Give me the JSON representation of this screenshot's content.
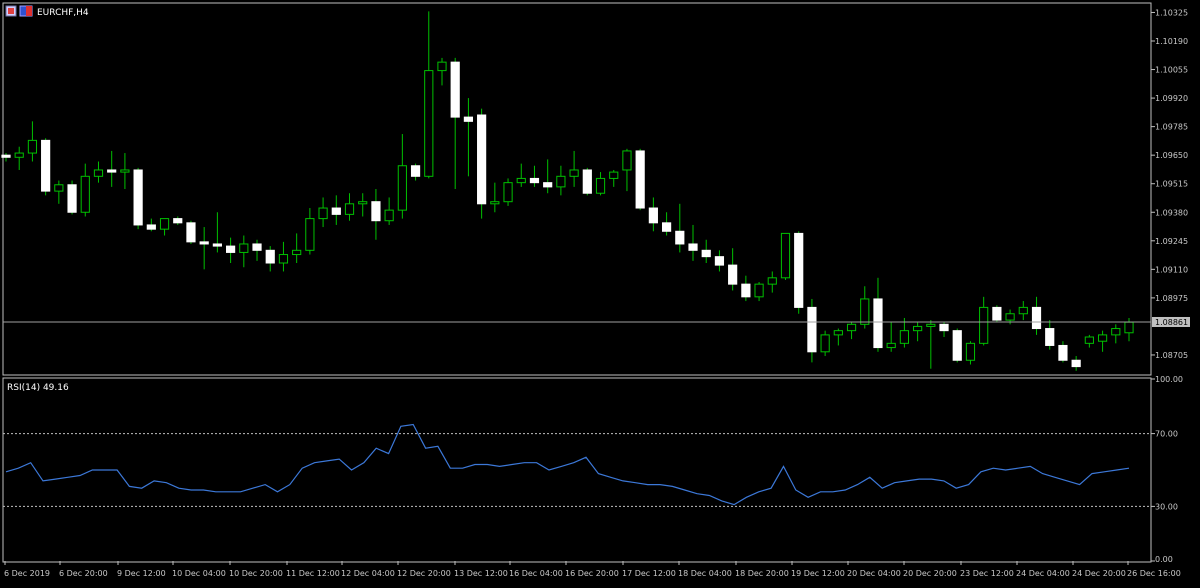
{
  "window": {
    "symbol_label": "EURCHF,H4"
  },
  "colors": {
    "background": "#000000",
    "frame": "#c0c0c0",
    "text": "#c8c8c8",
    "bull_candle_fill": "#000000",
    "bear_candle_fill": "#ffffff",
    "wick": "#00c000",
    "bull_border": "#00c000",
    "bear_border": "#ffffff",
    "price_line": "#a0a0a0",
    "rsi_line": "#3c78d8",
    "rsi_level": "#c0c0c0",
    "price_tag_bg": "#c0c0c0",
    "price_tag_text": "#000000"
  },
  "chart_data": [
    {
      "type": "candlestick",
      "title": "EURCHF,H4",
      "y_ticks": [
        "1.10325",
        "1.10190",
        "1.10055",
        "1.09920",
        "1.09785",
        "1.09650",
        "1.09515",
        "1.09380",
        "1.09245",
        "1.09110",
        "1.08975",
        "1.08705"
      ],
      "ylim": [
        1.08615,
        1.10365
      ],
      "current_price": 1.08861,
      "current_price_label": "1.08861",
      "x_ticks": [
        "6 Dec 2019",
        "6 Dec 20:00",
        "9 Dec 12:00",
        "10 Dec 04:00",
        "10 Dec 20:00",
        "11 Dec 12:00",
        "12 Dec 04:00",
        "12 Dec 20:00",
        "13 Dec 12:00",
        "16 Dec 04:00",
        "16 Dec 20:00",
        "17 Dec 12:00",
        "18 Dec 04:00",
        "18 Dec 20:00",
        "19 Dec 12:00",
        "20 Dec 04:00",
        "20 Dec 20:00",
        "23 Dec 12:00",
        "24 Dec 04:00",
        "24 Dec 20:00",
        "26 Dec 16:00"
      ],
      "candles": [
        {
          "o": 1.0965,
          "h": 1.0966,
          "l": 1.0962,
          "c": 1.0964
        },
        {
          "o": 1.0964,
          "h": 1.0969,
          "l": 1.0958,
          "c": 1.0966
        },
        {
          "o": 1.0966,
          "h": 1.0981,
          "l": 1.0962,
          "c": 1.0972
        },
        {
          "o": 1.0972,
          "h": 1.0973,
          "l": 1.0946,
          "c": 1.0948
        },
        {
          "o": 1.0948,
          "h": 1.0953,
          "l": 1.0942,
          "c": 1.0951
        },
        {
          "o": 1.0951,
          "h": 1.0953,
          "l": 1.0937,
          "c": 1.0938
        },
        {
          "o": 1.0938,
          "h": 1.0961,
          "l": 1.0936,
          "c": 1.0955
        },
        {
          "o": 1.0955,
          "h": 1.0962,
          "l": 1.0952,
          "c": 1.0958
        },
        {
          "o": 1.0958,
          "h": 1.0967,
          "l": 1.095,
          "c": 1.0957
        },
        {
          "o": 1.0957,
          "h": 1.0966,
          "l": 1.0949,
          "c": 1.0958
        },
        {
          "o": 1.0958,
          "h": 1.0959,
          "l": 1.093,
          "c": 1.0932
        },
        {
          "o": 1.0932,
          "h": 1.0935,
          "l": 1.0929,
          "c": 1.093
        },
        {
          "o": 1.093,
          "h": 1.0935,
          "l": 1.0927,
          "c": 1.0935
        },
        {
          "o": 1.0935,
          "h": 1.0936,
          "l": 1.0932,
          "c": 1.0933
        },
        {
          "o": 1.0933,
          "h": 1.0934,
          "l": 1.0923,
          "c": 1.0924
        },
        {
          "o": 1.0924,
          "h": 1.0931,
          "l": 1.0911,
          "c": 1.0923
        },
        {
          "o": 1.0923,
          "h": 1.0938,
          "l": 1.0919,
          "c": 1.0922
        },
        {
          "o": 1.0922,
          "h": 1.0926,
          "l": 1.0914,
          "c": 1.0919
        },
        {
          "o": 1.0919,
          "h": 1.0927,
          "l": 1.0912,
          "c": 1.0923
        },
        {
          "o": 1.0923,
          "h": 1.0925,
          "l": 1.0915,
          "c": 1.092
        },
        {
          "o": 1.092,
          "h": 1.0922,
          "l": 1.091,
          "c": 1.0914
        },
        {
          "o": 1.0914,
          "h": 1.0924,
          "l": 1.091,
          "c": 1.0918
        },
        {
          "o": 1.0918,
          "h": 1.0928,
          "l": 1.0914,
          "c": 1.092
        },
        {
          "o": 1.092,
          "h": 1.094,
          "l": 1.0918,
          "c": 1.0935
        },
        {
          "o": 1.0935,
          "h": 1.0945,
          "l": 1.0931,
          "c": 1.094
        },
        {
          "o": 1.094,
          "h": 1.0946,
          "l": 1.0932,
          "c": 1.0937
        },
        {
          "o": 1.0937,
          "h": 1.0947,
          "l": 1.0934,
          "c": 1.0942
        },
        {
          "o": 1.0942,
          "h": 1.0947,
          "l": 1.0936,
          "c": 1.0943
        },
        {
          "o": 1.0943,
          "h": 1.0949,
          "l": 1.0925,
          "c": 1.0934
        },
        {
          "o": 1.0934,
          "h": 1.0945,
          "l": 1.0932,
          "c": 1.0939
        },
        {
          "o": 1.0939,
          "h": 1.0975,
          "l": 1.0935,
          "c": 1.096
        },
        {
          "o": 1.096,
          "h": 1.0961,
          "l": 1.0953,
          "c": 1.0955
        },
        {
          "o": 1.0955,
          "h": 1.1033,
          "l": 1.0954,
          "c": 1.1005
        },
        {
          "o": 1.1005,
          "h": 1.1011,
          "l": 1.0998,
          "c": 1.1009
        },
        {
          "o": 1.1009,
          "h": 1.1011,
          "l": 1.0949,
          "c": 1.0983
        },
        {
          "o": 1.0983,
          "h": 1.0992,
          "l": 1.0955,
          "c": 1.0981
        },
        {
          "o": 1.0984,
          "h": 1.0987,
          "l": 1.0935,
          "c": 1.0942
        },
        {
          "o": 1.0942,
          "h": 1.0952,
          "l": 1.0938,
          "c": 1.0943
        },
        {
          "o": 1.0943,
          "h": 1.0954,
          "l": 1.0941,
          "c": 1.0952
        },
        {
          "o": 1.0952,
          "h": 1.0961,
          "l": 1.095,
          "c": 1.0954
        },
        {
          "o": 1.0954,
          "h": 1.096,
          "l": 1.095,
          "c": 1.0952
        },
        {
          "o": 1.0952,
          "h": 1.0963,
          "l": 1.0947,
          "c": 1.095
        },
        {
          "o": 1.095,
          "h": 1.096,
          "l": 1.0946,
          "c": 1.0955
        },
        {
          "o": 1.0955,
          "h": 1.0967,
          "l": 1.095,
          "c": 1.0958
        },
        {
          "o": 1.0958,
          "h": 1.0959,
          "l": 1.0946,
          "c": 1.0947
        },
        {
          "o": 1.0947,
          "h": 1.0957,
          "l": 1.0946,
          "c": 1.0954
        },
        {
          "o": 1.0954,
          "h": 1.0958,
          "l": 1.095,
          "c": 1.0957
        },
        {
          "o": 1.0958,
          "h": 1.0968,
          "l": 1.0948,
          "c": 1.0967
        },
        {
          "o": 1.0967,
          "h": 1.0968,
          "l": 1.0939,
          "c": 1.094
        },
        {
          "o": 1.094,
          "h": 1.0945,
          "l": 1.0929,
          "c": 1.0933
        },
        {
          "o": 1.0933,
          "h": 1.0938,
          "l": 1.0927,
          "c": 1.0929
        },
        {
          "o": 1.0929,
          "h": 1.0942,
          "l": 1.0919,
          "c": 1.0923
        },
        {
          "o": 1.0923,
          "h": 1.0932,
          "l": 1.0915,
          "c": 1.092
        },
        {
          "o": 1.092,
          "h": 1.0925,
          "l": 1.0914,
          "c": 1.0917
        },
        {
          "o": 1.0917,
          "h": 1.092,
          "l": 1.091,
          "c": 1.0913
        },
        {
          "o": 1.0913,
          "h": 1.0921,
          "l": 1.0901,
          "c": 1.0904
        },
        {
          "o": 1.0904,
          "h": 1.0908,
          "l": 1.0896,
          "c": 1.0898
        },
        {
          "o": 1.0898,
          "h": 1.0905,
          "l": 1.0896,
          "c": 1.0904
        },
        {
          "o": 1.0904,
          "h": 1.091,
          "l": 1.09,
          "c": 1.0907
        },
        {
          "o": 1.0907,
          "h": 1.0928,
          "l": 1.0906,
          "c": 1.0928
        },
        {
          "o": 1.0928,
          "h": 1.0929,
          "l": 1.089,
          "c": 1.0893
        },
        {
          "o": 1.0893,
          "h": 1.0897,
          "l": 1.0867,
          "c": 1.0872
        },
        {
          "o": 1.0872,
          "h": 1.0882,
          "l": 1.087,
          "c": 1.088
        },
        {
          "o": 1.088,
          "h": 1.0883,
          "l": 1.0875,
          "c": 1.0882
        },
        {
          "o": 1.0882,
          "h": 1.0886,
          "l": 1.0878,
          "c": 1.0885
        },
        {
          "o": 1.0885,
          "h": 1.0903,
          "l": 1.0883,
          "c": 1.0897
        },
        {
          "o": 1.0897,
          "h": 1.0907,
          "l": 1.0872,
          "c": 1.0874
        },
        {
          "o": 1.0874,
          "h": 1.0886,
          "l": 1.0872,
          "c": 1.0876
        },
        {
          "o": 1.0876,
          "h": 1.0888,
          "l": 1.0874,
          "c": 1.0882
        },
        {
          "o": 1.0882,
          "h": 1.0886,
          "l": 1.0877,
          "c": 1.0884
        },
        {
          "o": 1.0884,
          "h": 1.0887,
          "l": 1.0864,
          "c": 1.0885
        },
        {
          "o": 1.0885,
          "h": 1.0886,
          "l": 1.0879,
          "c": 1.0882
        },
        {
          "o": 1.0882,
          "h": 1.0883,
          "l": 1.0867,
          "c": 1.0868
        },
        {
          "o": 1.0868,
          "h": 1.0877,
          "l": 1.0866,
          "c": 1.0876
        },
        {
          "o": 1.0876,
          "h": 1.0898,
          "l": 1.0875,
          "c": 1.0893
        },
        {
          "o": 1.0893,
          "h": 1.0894,
          "l": 1.0886,
          "c": 1.0887
        },
        {
          "o": 1.0887,
          "h": 1.0892,
          "l": 1.0885,
          "c": 1.089
        },
        {
          "o": 1.089,
          "h": 1.0896,
          "l": 1.0887,
          "c": 1.0893
        },
        {
          "o": 1.0893,
          "h": 1.0898,
          "l": 1.088,
          "c": 1.0883
        },
        {
          "o": 1.0883,
          "h": 1.0887,
          "l": 1.0873,
          "c": 1.0875
        },
        {
          "o": 1.0875,
          "h": 1.0877,
          "l": 1.0867,
          "c": 1.0868
        },
        {
          "o": 1.0868,
          "h": 1.087,
          "l": 1.0863,
          "c": 1.0865
        },
        {
          "o": 1.0876,
          "h": 1.088,
          "l": 1.0874,
          "c": 1.0879
        },
        {
          "o": 1.0877,
          "h": 1.0882,
          "l": 1.0872,
          "c": 1.088
        },
        {
          "o": 1.088,
          "h": 1.0885,
          "l": 1.0876,
          "c": 1.0883
        },
        {
          "o": 1.0881,
          "h": 1.0888,
          "l": 1.0877,
          "c": 1.0886
        }
      ]
    },
    {
      "type": "line",
      "title": "RSI(14) 49.16",
      "series_name": "RSI(14)",
      "last_value": 49.16,
      "ylim": [
        0,
        100
      ],
      "y_ticks": [
        "100.00",
        "70.00",
        "30.00",
        "0.00"
      ],
      "levels": [
        70,
        30
      ],
      "values": [
        49,
        51,
        54,
        44,
        45,
        46,
        47,
        50,
        50,
        50,
        41,
        40,
        44,
        43,
        40,
        39,
        39,
        38,
        38,
        38,
        40,
        42,
        38,
        42,
        51,
        54,
        55,
        56,
        50,
        54,
        62,
        59,
        74,
        75,
        62,
        63,
        51,
        51,
        53,
        53,
        52,
        53,
        54,
        54,
        50,
        52,
        54,
        57,
        48,
        46,
        44,
        43,
        42,
        42,
        41,
        39,
        37,
        36,
        33,
        31,
        35,
        38,
        40,
        52,
        39,
        35,
        38,
        38,
        39,
        42,
        46,
        40,
        43,
        44,
        45,
        45,
        44,
        40,
        42,
        49,
        51,
        50,
        51,
        52,
        48,
        46,
        44,
        42,
        48,
        49,
        50,
        51
      ]
    }
  ]
}
